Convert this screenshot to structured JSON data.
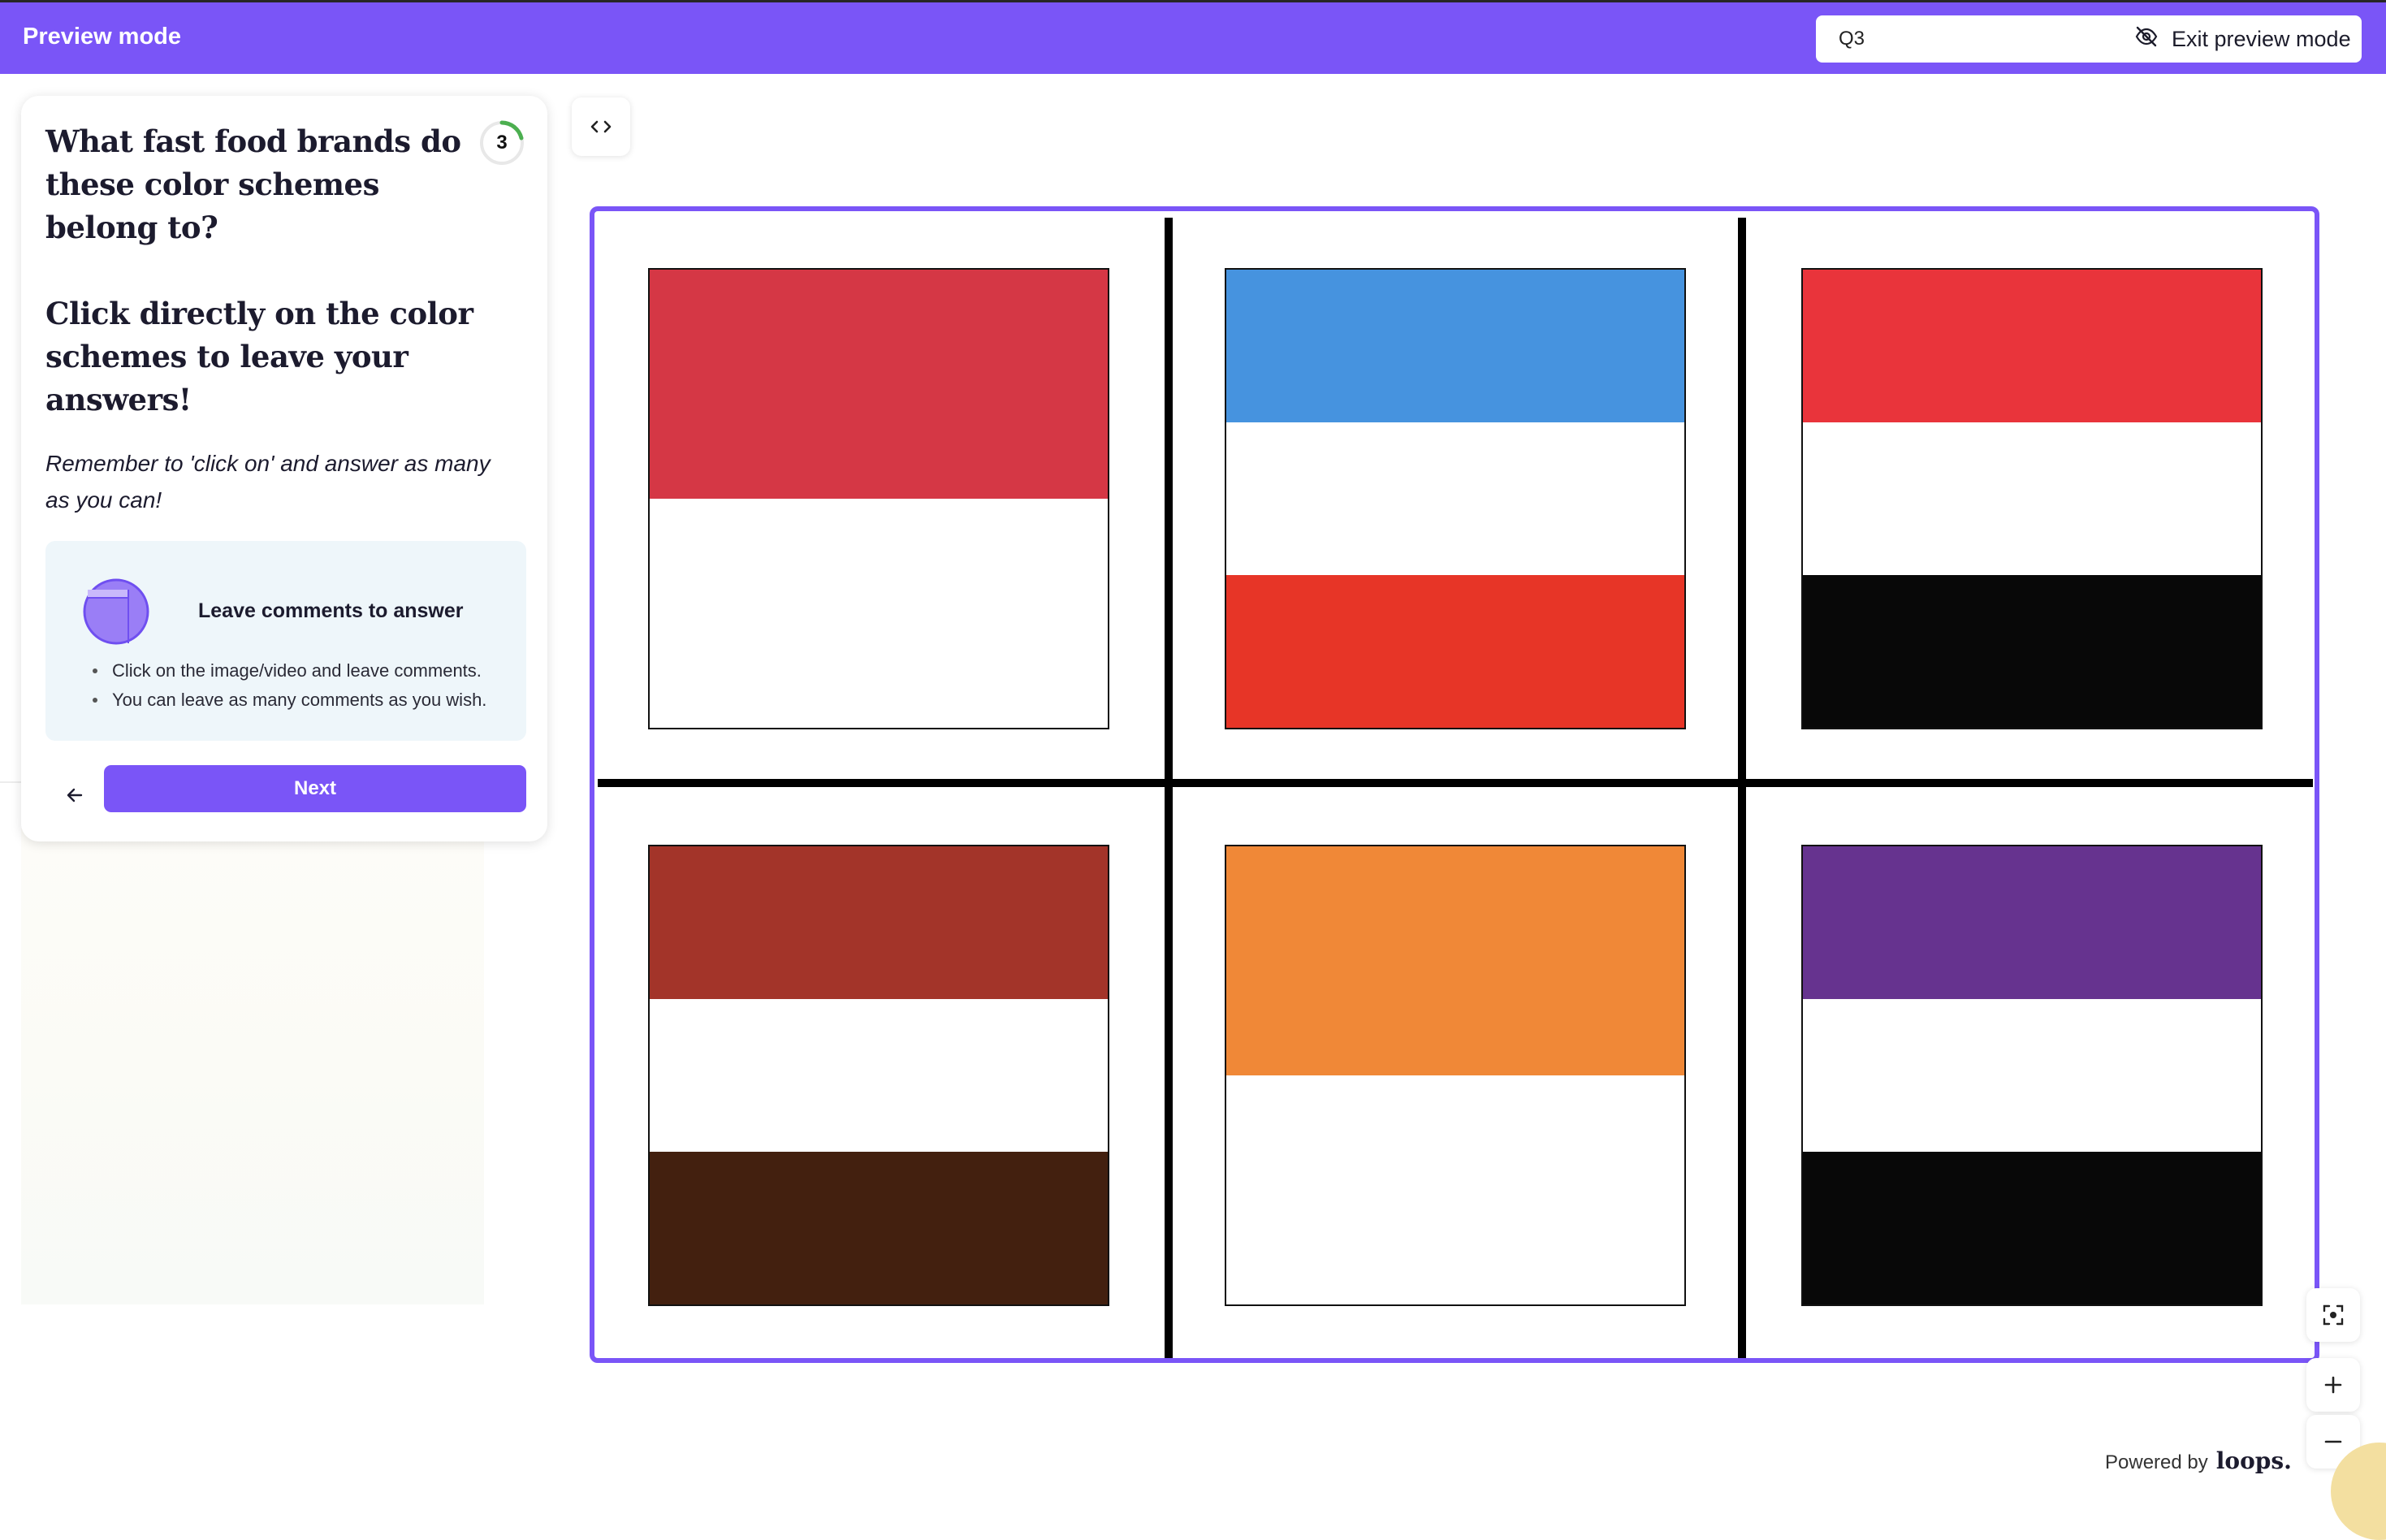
{
  "topbar": {
    "title": "Preview mode",
    "question_select": {
      "value": "Q3"
    },
    "exit_label": "Exit preview mode"
  },
  "card": {
    "title": "What fast food brands do these color schemes belong to?",
    "subtitle": "Click directly on the color schemes to leave your answers!",
    "note": "Remember to 'click on' and answer as many as you can!",
    "question_number": "3",
    "hint": {
      "title": "Leave comments to answer",
      "items": [
        "Click on the image/video and leave comments.",
        "You can leave as many comments as you wish."
      ]
    },
    "next_label": "Next"
  },
  "footer": {
    "powered_label": "Powered by",
    "brand": "loops."
  },
  "colors": {
    "accent": "#7a55f7",
    "progress": "#4caf50"
  },
  "color_schemes": [
    {
      "bands": [
        [
          "#d53745",
          1
        ],
        [
          "#ffffff",
          1
        ]
      ]
    },
    {
      "bands": [
        [
          "#4693df",
          1
        ],
        [
          "#ffffff",
          1
        ],
        [
          "#e73527",
          1
        ]
      ]
    },
    {
      "bands": [
        [
          "#e9343b",
          1
        ],
        [
          "#ffffff",
          1
        ],
        [
          "#080808",
          1
        ]
      ]
    },
    {
      "bands": [
        [
          "#a33429",
          1
        ],
        [
          "#ffffff",
          1
        ],
        [
          "#43200f",
          1
        ]
      ]
    },
    {
      "bands": [
        [
          "#f08837",
          1
        ],
        [
          "#ffffff",
          1
        ]
      ]
    },
    {
      "bands": [
        [
          "#66338f",
          1
        ],
        [
          "#ffffff",
          1
        ],
        [
          "#080808",
          1
        ]
      ]
    }
  ]
}
